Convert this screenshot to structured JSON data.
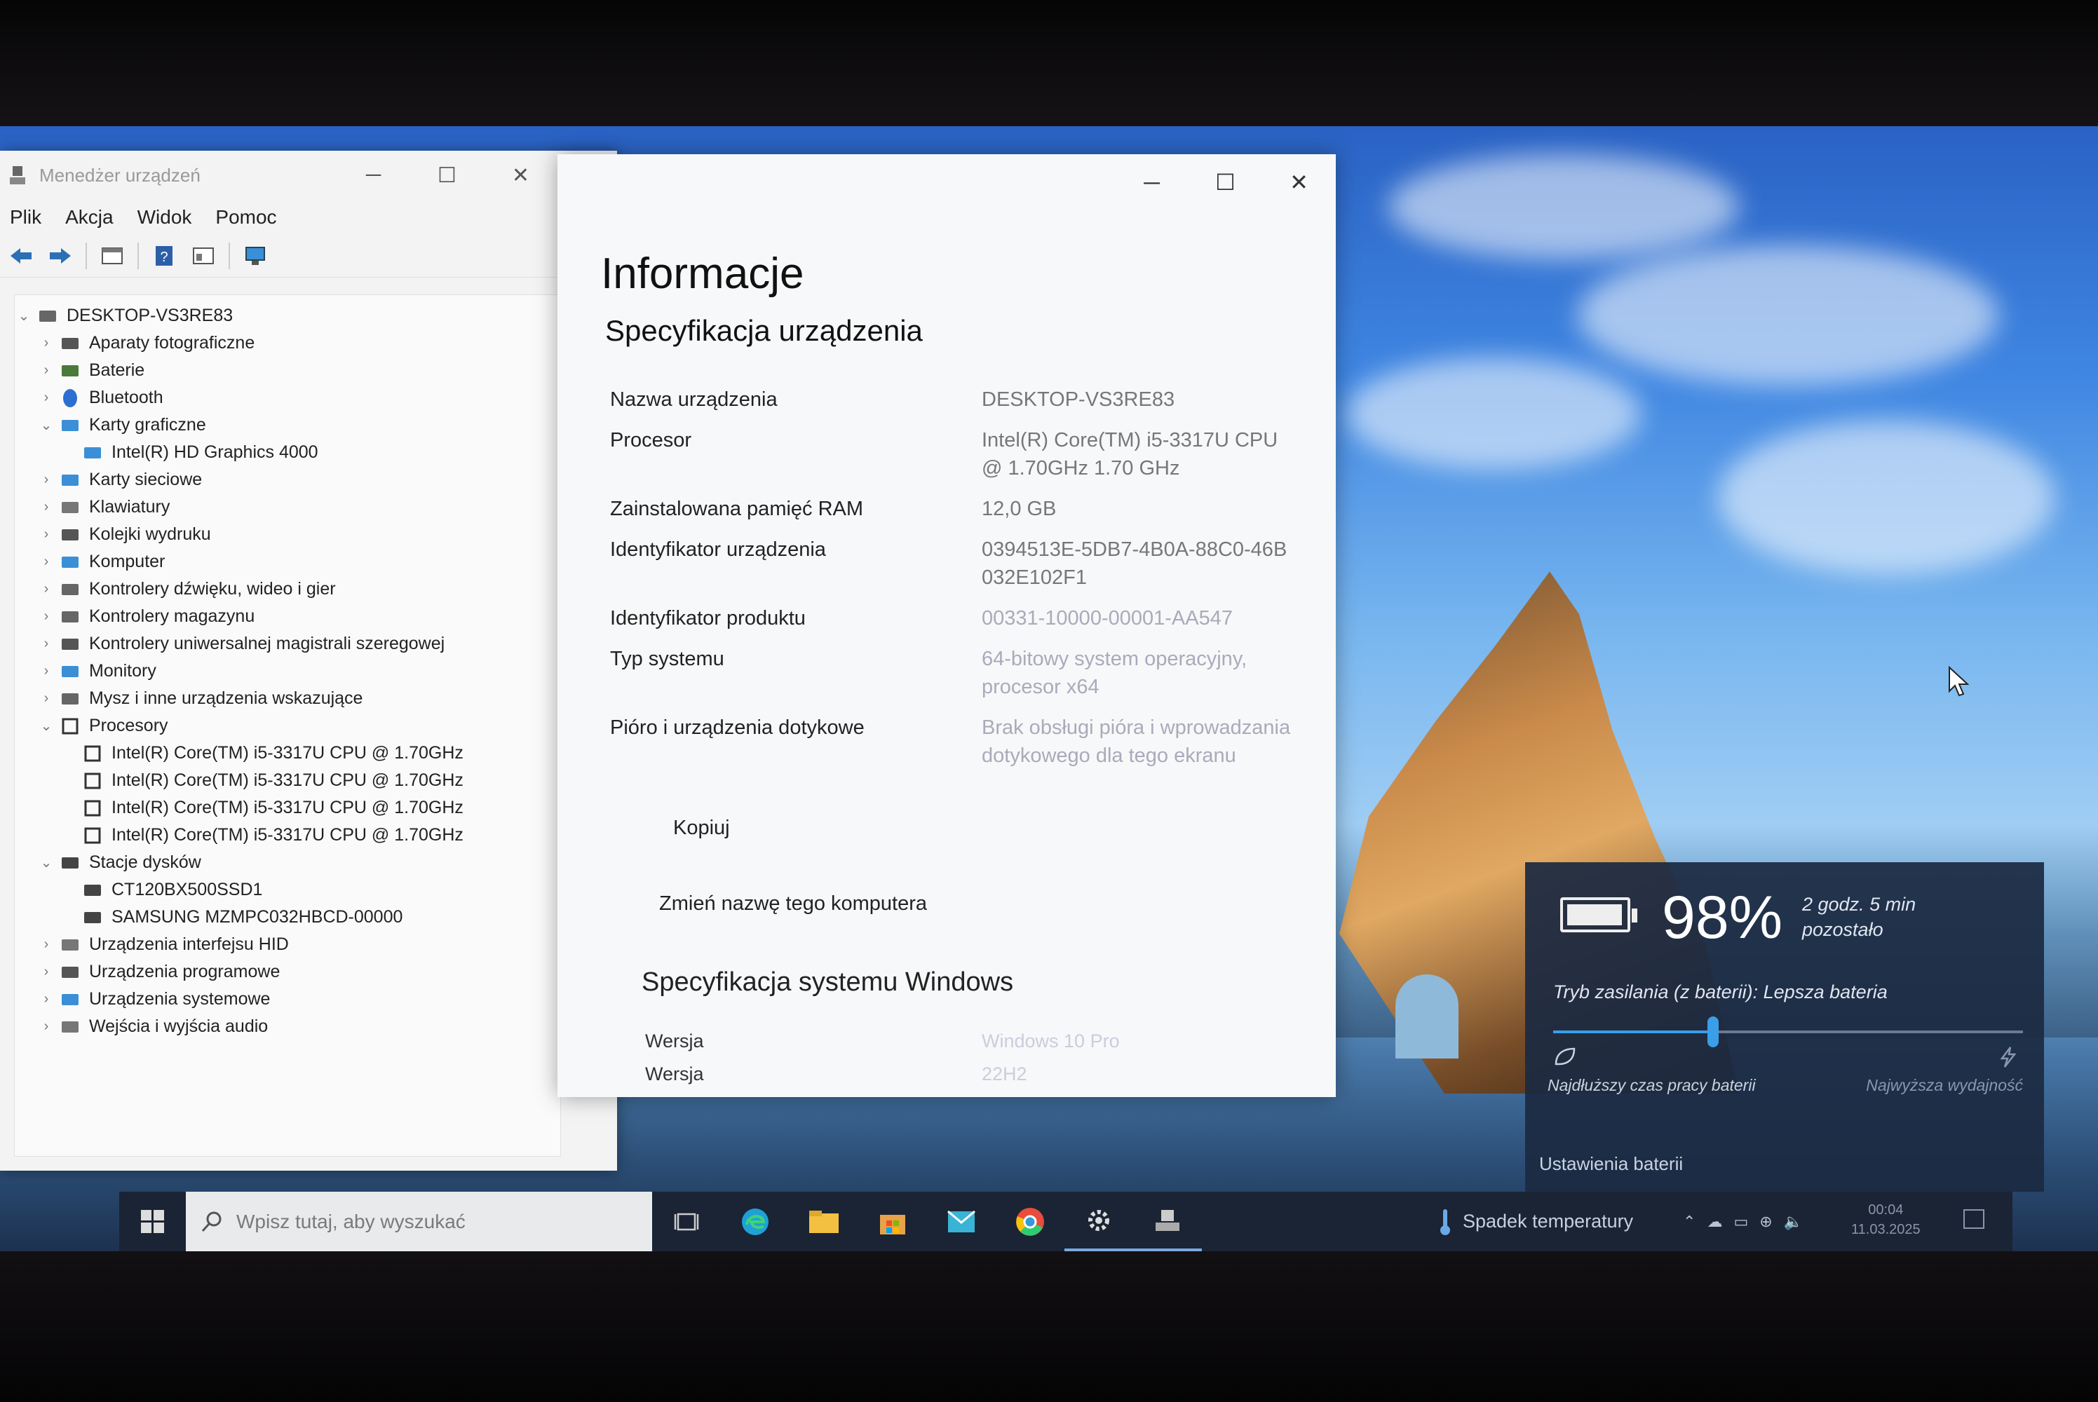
{
  "device_manager": {
    "title": "Menedżer urządzeń",
    "menu": [
      "Plik",
      "Akcja",
      "Widok",
      "Pomoc"
    ],
    "tree": [
      {
        "label": "DESKTOP-VS3RE83",
        "level": 0,
        "expander": "v",
        "icon": "computer-icon"
      },
      {
        "label": "Aparaty fotograficzne",
        "level": 1,
        "expander": ">",
        "icon": "camera-icon"
      },
      {
        "label": "Baterie",
        "level": 1,
        "expander": ">",
        "icon": "battery-icon"
      },
      {
        "label": "Bluetooth",
        "level": 1,
        "expander": ">",
        "icon": "bluetooth-icon"
      },
      {
        "label": "Karty graficzne",
        "level": 1,
        "expander": "v",
        "icon": "display-adapter-icon"
      },
      {
        "label": "Intel(R) HD Graphics 4000",
        "level": 2,
        "expander": "",
        "icon": "display-adapter-icon"
      },
      {
        "label": "Karty sieciowe",
        "level": 1,
        "expander": ">",
        "icon": "network-adapter-icon"
      },
      {
        "label": "Klawiatury",
        "level": 1,
        "expander": ">",
        "icon": "keyboard-icon"
      },
      {
        "label": "Kolejki wydruku",
        "level": 1,
        "expander": ">",
        "icon": "printer-icon"
      },
      {
        "label": "Komputer",
        "level": 1,
        "expander": ">",
        "icon": "monitor-icon"
      },
      {
        "label": "Kontrolery dźwięku, wideo i gier",
        "level": 1,
        "expander": ">",
        "icon": "speaker-icon"
      },
      {
        "label": "Kontrolery magazynu",
        "level": 1,
        "expander": ">",
        "icon": "storage-icon"
      },
      {
        "label": "Kontrolery uniwersalnej magistrali szeregowej",
        "level": 1,
        "expander": ">",
        "icon": "usb-icon"
      },
      {
        "label": "Monitory",
        "level": 1,
        "expander": ">",
        "icon": "monitor-icon"
      },
      {
        "label": "Mysz i inne urządzenia wskazujące",
        "level": 1,
        "expander": ">",
        "icon": "mouse-icon"
      },
      {
        "label": "Procesory",
        "level": 1,
        "expander": "v",
        "icon": "cpu-icon"
      },
      {
        "label": "Intel(R) Core(TM) i5-3317U CPU @ 1.70GHz",
        "level": 2,
        "expander": "",
        "icon": "cpu-icon"
      },
      {
        "label": "Intel(R) Core(TM) i5-3317U CPU @ 1.70GHz",
        "level": 2,
        "expander": "",
        "icon": "cpu-icon"
      },
      {
        "label": "Intel(R) Core(TM) i5-3317U CPU @ 1.70GHz",
        "level": 2,
        "expander": "",
        "icon": "cpu-icon"
      },
      {
        "label": "Intel(R) Core(TM) i5-3317U CPU @ 1.70GHz",
        "level": 2,
        "expander": "",
        "icon": "cpu-icon"
      },
      {
        "label": "Stacje dysków",
        "level": 1,
        "expander": "v",
        "icon": "disk-drive-icon"
      },
      {
        "label": "CT120BX500SSD1",
        "level": 2,
        "expander": "",
        "icon": "disk-drive-icon"
      },
      {
        "label": "SAMSUNG MZMPC032HBCD-00000",
        "level": 2,
        "expander": "",
        "icon": "disk-drive-icon"
      },
      {
        "label": "Urządzenia interfejsu HID",
        "level": 1,
        "expander": ">",
        "icon": "hid-icon"
      },
      {
        "label": "Urządzenia programowe",
        "level": 1,
        "expander": ">",
        "icon": "software-device-icon"
      },
      {
        "label": "Urządzenia systemowe",
        "level": 1,
        "expander": ">",
        "icon": "system-device-icon"
      },
      {
        "label": "Wejścia i wyjścia audio",
        "level": 1,
        "expander": ">",
        "icon": "audio-io-icon"
      }
    ]
  },
  "settings": {
    "title": "Informacje",
    "device_specs_heading": "Specyfikacja urządzenia",
    "specs": [
      {
        "key": "Nazwa urządzenia",
        "value": "DESKTOP-VS3RE83"
      },
      {
        "key": "Procesor",
        "value": "Intel(R) Core(TM) i5-3317U CPU @ 1.70GHz   1.70 GHz"
      },
      {
        "key": "Zainstalowana pamięć RAM",
        "value": "12,0 GB"
      },
      {
        "key": "Identyfikator urządzenia",
        "value": "0394513E-5DB7-4B0A-88C0-46B032E102F1"
      },
      {
        "key": "Identyfikator produktu",
        "value": "00331-10000-00001-AA547"
      },
      {
        "key": "Typ systemu",
        "value": "64-bitowy system operacyjny, procesor x64"
      },
      {
        "key": "Pióro i urządzenia dotykowe",
        "value": "Brak obsługi pióra i wprowadzania dotykowego dla tego ekranu"
      }
    ],
    "copy_button": "Kopiuj",
    "rename_link": "Zmień nazwę tego komputera",
    "windows_specs_heading": "Specyfikacja systemu Windows",
    "windows_specs": [
      {
        "key": "Wersja",
        "value": "Windows 10 Pro"
      },
      {
        "key": "Wersja",
        "value": "22H2"
      }
    ]
  },
  "battery": {
    "percent": "98%",
    "remaining": "2 godz. 5 min pozostało",
    "mode": "Tryb zasilania (z baterii): Lepsza bateria",
    "slider_level": 0.34,
    "label_left": "Najdłuższy czas pracy baterii",
    "label_right": "Najwyższa wydajność",
    "settings_link": "Ustawienia baterii"
  },
  "taskbar": {
    "search_placeholder": "Wpisz tutaj, aby wyszukać",
    "weather": "Spadek temperatury",
    "time": "00:04",
    "date": "11.03.2025"
  }
}
